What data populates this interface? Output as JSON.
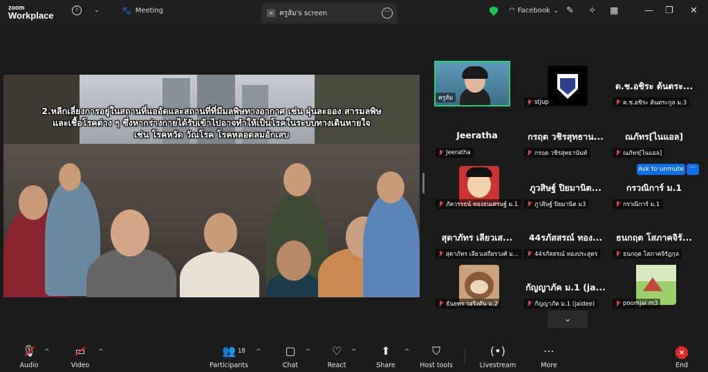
{
  "app": {
    "logo_top": "zoom",
    "logo_bottom": "Workplace"
  },
  "topbar": {
    "meeting_label": "Meeting",
    "tab_avatar": "ค",
    "tab_title": "ครูส้ม's screen",
    "facebook_label": "Facebook"
  },
  "share": {
    "caption_lines": [
      "2.หลีกเลี่ยงการอยู่ในสถานที่แออัดและสถานที่ที่มีมลพิษทางอากาศ เช่น ฝุ่นละออง สารมลพิษ",
      "และเชื้อโรคต่าง ๆ ซึ่งหากร่างกายได้รับเข้าไปอาจทำให้เป็นโรคในระบบทางเดินหายใจ",
      "เช่น โรคหวัด วัณโรค โรคหลอดลมอักเสบ"
    ]
  },
  "gallery": {
    "tiles": [
      {
        "big": "",
        "tag": "ครูส้ม",
        "type": "video"
      },
      {
        "big": "",
        "tag": "stjup",
        "type": "picture",
        "pic": "crest"
      },
      {
        "big": "ด.ช.อชิระ ต้นตระ...",
        "tag": "ด.ช.อชิระ ต้นตระกูล ม.3"
      },
      {
        "big": "Jeeratha",
        "tag": "Jeeratha"
      },
      {
        "big": "กรฤต วชิรสุทธาน...",
        "tag": "กรฤต วชิรสุทธานันท์"
      },
      {
        "big": "ณภัทร[ไนแอล]",
        "tag": "ณภัทร[ไนแอล]"
      },
      {
        "big": "",
        "tag": "ภัควรรธน์ ทองธนเศรษฐ์ ม.1",
        "type": "picture",
        "pic": "cartoon"
      },
      {
        "big": "ภูวสิษฐ์ ปิยมานิต...",
        "tag": "ภูวสิษฐ์ ปิยมานิต ม3"
      },
      {
        "big": "กรวณิการ์ ม.1",
        "tag": "กรวณิการ์ ม.1"
      },
      {
        "big": "สุดาภัทร เลียวเส...",
        "tag": "สุดาภัทร เลียวเสถียรวงศ์ ม..."
      },
      {
        "big": "44รภัสสรณ์ ทอง...",
        "tag": "44รภัสสรณ์ ทองประสูตร"
      },
      {
        "big": "ธนกฤต โสภาคจิรั...",
        "tag": "ธนกฤต โสภาคจิรัฏกุล"
      },
      {
        "big": "",
        "tag": "ธันยพร วอริงตัน ม.2",
        "type": "picture",
        "pic": "bear"
      },
      {
        "big": "กัญญาภัค ม.1 (ja...",
        "tag": "กัญญาภัค ม.1 (jaidee)"
      },
      {
        "big": "",
        "tag": "poomjai m3",
        "type": "picture",
        "pic": "scene"
      }
    ],
    "ask_to_unmute": "Ask to unmute",
    "ask_more": "···"
  },
  "toolbar": {
    "audio": "Audio",
    "video": "Video",
    "participants": "Participants",
    "participants_count": "18",
    "chat": "Chat",
    "react": "React",
    "share": "Share",
    "host_tools": "Host tools",
    "livestream": "Livestream",
    "more": "More",
    "end": "End"
  }
}
